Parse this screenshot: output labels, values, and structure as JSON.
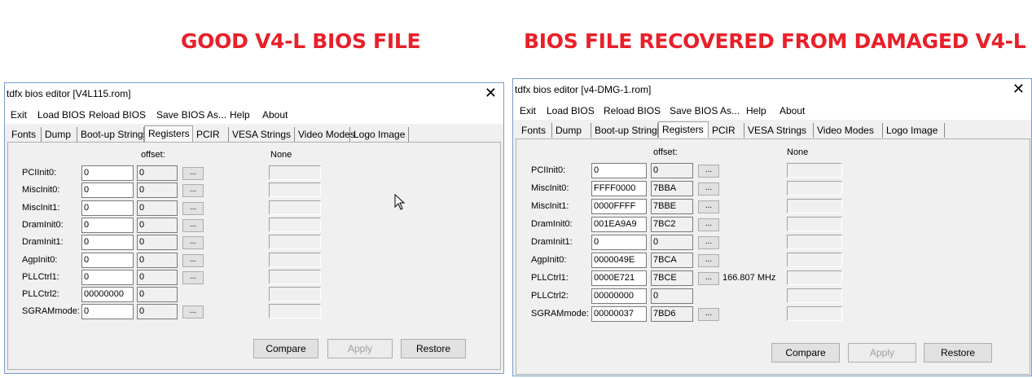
{
  "headings": {
    "left": "GOOD V4-L BIOS FILE",
    "right": "BIOS FILE RECOVERED FROM DAMAGED V4-L"
  },
  "left_window": {
    "title": "tdfx bios editor [V4L115.rom]",
    "close": "✕",
    "menu": [
      "Exit",
      "Load BIOS",
      "Reload BIOS",
      "Save BIOS As...",
      "Help",
      "About"
    ],
    "tabs": [
      "Fonts",
      "Dump",
      "Boot-up Strings",
      "Registers",
      "PCIR",
      "VESA Strings",
      "Video Modes",
      "Logo Image"
    ],
    "active_tab": "Registers",
    "offset_header": "offset:",
    "none_header": "None",
    "rows": [
      {
        "label": "PCIInit0:",
        "value": "0",
        "offset": "0",
        "dots": "...",
        "extra": ""
      },
      {
        "label": "MiscInit0:",
        "value": "0",
        "offset": "0",
        "dots": "...",
        "extra": ""
      },
      {
        "label": "MiscInit1:",
        "value": "0",
        "offset": "0",
        "dots": "...",
        "extra": ""
      },
      {
        "label": "DramInit0:",
        "value": "0",
        "offset": "0",
        "dots": "...",
        "extra": ""
      },
      {
        "label": "DramInit1:",
        "value": "0",
        "offset": "0",
        "dots": "...",
        "extra": ""
      },
      {
        "label": "AgpInit0:",
        "value": "0",
        "offset": "0",
        "dots": "...",
        "extra": ""
      },
      {
        "label": "PLLCtrl1:",
        "value": "0",
        "offset": "0",
        "dots": "...",
        "extra": ""
      },
      {
        "label": "PLLCtrl2:",
        "value": "00000000",
        "offset": "0",
        "dots": "",
        "extra": ""
      },
      {
        "label": "SGRAMmode:",
        "value": "0",
        "offset": "0",
        "dots": "...",
        "extra": ""
      }
    ],
    "buttons": {
      "compare": "Compare",
      "apply": "Apply",
      "restore": "Restore"
    }
  },
  "right_window": {
    "title": "tdfx bios editor [v4-DMG-1.rom]",
    "close": "✕",
    "menu": [
      "Exit",
      "Load BIOS",
      "Reload BIOS",
      "Save BIOS As...",
      "Help",
      "About"
    ],
    "tabs": [
      "Fonts",
      "Dump",
      "Boot-up Strings",
      "Registers",
      "PCIR",
      "VESA Strings",
      "Video Modes",
      "Logo Image"
    ],
    "active_tab": "Registers",
    "offset_header": "offset:",
    "none_header": "None",
    "rows": [
      {
        "label": "PCIInit0:",
        "value": "0",
        "offset": "0",
        "dots": "...",
        "extra": ""
      },
      {
        "label": "MiscInit0:",
        "value": "FFFF0000",
        "offset": "7BBA",
        "dots": "...",
        "extra": ""
      },
      {
        "label": "MiscInit1:",
        "value": "0000FFFF",
        "offset": "7BBE",
        "dots": "...",
        "extra": ""
      },
      {
        "label": "DramInit0:",
        "value": "001EA9A9",
        "offset": "7BC2",
        "dots": "...",
        "extra": ""
      },
      {
        "label": "DramInit1:",
        "value": "0",
        "offset": "0",
        "dots": "...",
        "extra": ""
      },
      {
        "label": "AgpInit0:",
        "value": "0000049E",
        "offset": "7BCA",
        "dots": "...",
        "extra": ""
      },
      {
        "label": "PLLCtrl1:",
        "value": "0000E721",
        "offset": "7BCE",
        "dots": "...",
        "extra": "166.807 MHz"
      },
      {
        "label": "PLLCtrl2:",
        "value": "00000000",
        "offset": "0",
        "dots": "",
        "extra": ""
      },
      {
        "label": "SGRAMmode:",
        "value": "00000037",
        "offset": "7BD6",
        "dots": "...",
        "extra": ""
      }
    ],
    "buttons": {
      "compare": "Compare",
      "apply": "Apply",
      "restore": "Restore"
    }
  }
}
